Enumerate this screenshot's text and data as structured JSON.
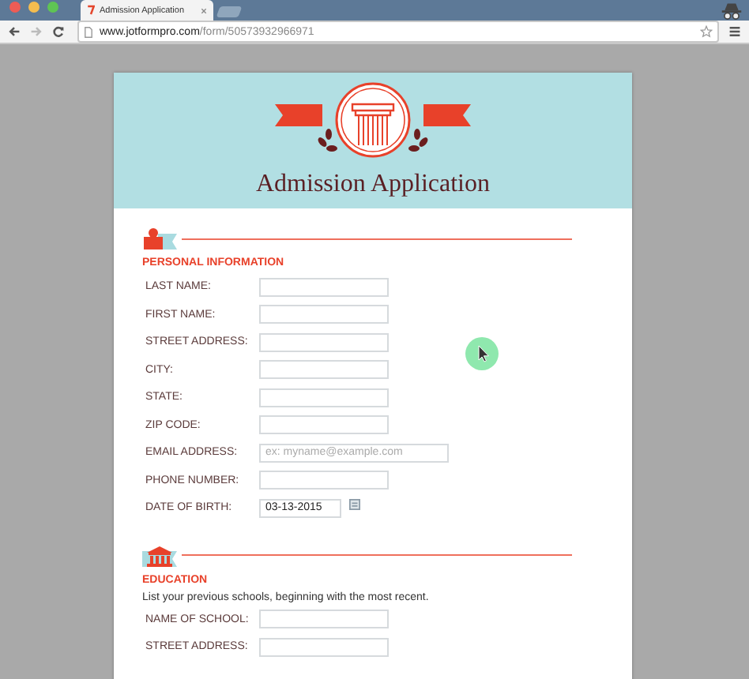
{
  "browser": {
    "tab_title": "Admission Application",
    "url_host": "www.jotformpro.com",
    "url_path": "/form/50573932966971"
  },
  "form": {
    "title": "Admission Application",
    "sections": [
      {
        "heading": "PERSONAL INFORMATION",
        "fields": [
          {
            "label": "LAST NAME:",
            "kind": "text"
          },
          {
            "label": "FIRST NAME:",
            "kind": "text"
          },
          {
            "label": "STREET ADDRESS:",
            "kind": "text"
          },
          {
            "label": "CITY:",
            "kind": "text"
          },
          {
            "label": "STATE:",
            "kind": "text"
          },
          {
            "label": "ZIP CODE:",
            "kind": "text"
          },
          {
            "label": "EMAIL ADDRESS:",
            "kind": "email",
            "placeholder": "ex: myname@example.com"
          },
          {
            "label": "PHONE NUMBER:",
            "kind": "text"
          },
          {
            "label": "DATE OF BIRTH:",
            "kind": "date",
            "value": "03-13-2015"
          }
        ]
      },
      {
        "heading": "EDUCATION",
        "description": "List your previous schools, beginning with the most recent.",
        "fields": [
          {
            "label": "NAME OF SCHOOL:",
            "kind": "text"
          },
          {
            "label": "STREET ADDRESS:",
            "kind": "text"
          }
        ]
      }
    ]
  }
}
